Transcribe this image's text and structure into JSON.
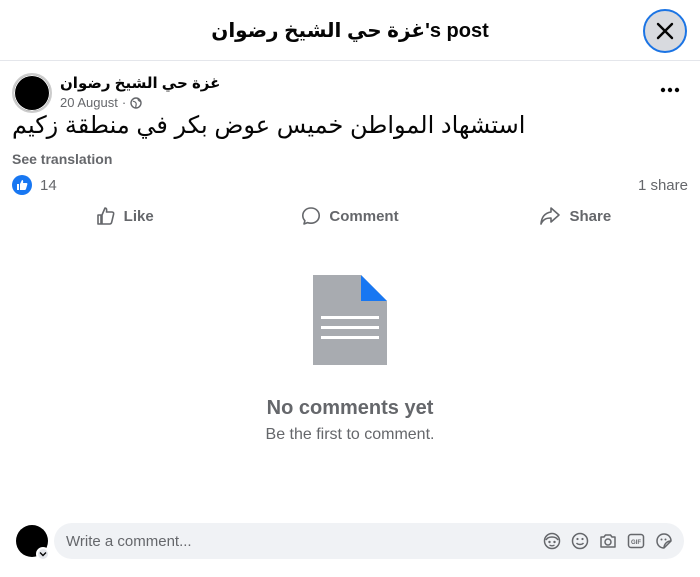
{
  "header": {
    "title": "غزة حي الشيخ رضوان's post"
  },
  "post": {
    "author": "غزة حي الشيخ رضوان",
    "date": "20 August",
    "separator": "·",
    "privacy_icon": "globe-icon",
    "text": "استشهاد المواطن خميس عوض بكر في منطقة زكيم",
    "see_translation": "See translation",
    "reaction_count": "14",
    "share_count": "1 share"
  },
  "actions": {
    "like": "Like",
    "comment": "Comment",
    "share": "Share"
  },
  "comments": {
    "empty_title": "No comments yet",
    "empty_subtitle": "Be the first to comment."
  },
  "composer": {
    "placeholder": "Write a comment..."
  },
  "colors": {
    "accent": "#1877f2",
    "secondary_text": "#65676b",
    "input_bg": "#f0f2f5"
  }
}
